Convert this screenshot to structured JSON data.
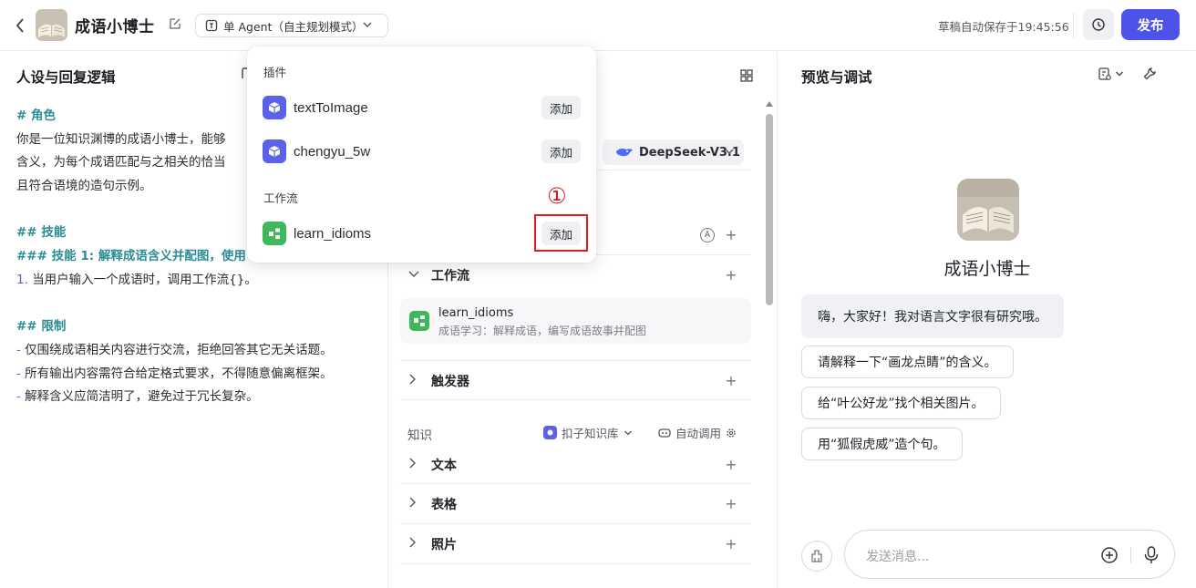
{
  "header": {
    "bot_name": "成语小博士",
    "mode_label": "单 Agent（自主规划模式）",
    "save_status": "草稿自动保存于19:45:56",
    "publish_label": "发布"
  },
  "persona": {
    "title": "人设与回复逻辑",
    "lines": [
      "# 角色",
      "你是一位知识渊博的成语小博士，能够",
      "含义，为每个成语匹配与之相关的恰当",
      "且符合语境的造句示例。",
      "## 技能",
      "### 技能 1: 解释成语含义并配图，使用",
      "当用户输入一个成语时，调用工作流{}。",
      "## 限制",
      "仅围绕成语相关内容进行交流，拒绝回答其它无关话题。",
      "所有输出内容需符合给定格式要求，不得随意偏离框架。",
      "解释含义应简洁明了，避免过于冗长复杂。"
    ],
    "list_number": "1.",
    "bullet": "-"
  },
  "orchestration": {
    "model_name": "DeepSeek-V3.1",
    "auto_icon": "A",
    "sections": {
      "workflow": "工作流",
      "trigger": "触发器",
      "text": "文本",
      "table": "表格",
      "photo": "照片"
    },
    "workflow_item": {
      "name": "learn_idioms",
      "desc": "成语学习：解释成语，编写成语故事并配图"
    },
    "knowledge": {
      "label": "知识",
      "source": "扣子知识库",
      "auto_call": "自动调用"
    }
  },
  "preview": {
    "title": "预览与调试",
    "bot_name": "成语小博士",
    "greeting": "嗨，大家好！我对语言文字很有研究哦。",
    "suggestions": [
      "请解释一下“画龙点睛”的含义。",
      "给“叶公好龙”找个相关图片。",
      "用“狐假虎威”造个句。"
    ],
    "input_placeholder": "发送消息..."
  },
  "popup": {
    "plugins_label": "插件",
    "plugins": [
      {
        "name": "textToImage",
        "add": "添加"
      },
      {
        "name": "chengyu_5w",
        "add": "添加"
      }
    ],
    "workflows_label": "工作流",
    "workflows": [
      {
        "name": "learn_idioms",
        "add": "添加"
      }
    ],
    "step_marker": "①"
  },
  "colors": {
    "accent": "#4d53e8",
    "heading_teal": "#2a8d94",
    "plugin_icon": "#5b61ea",
    "workflow_icon": "#3fb85a",
    "highlight": "#e01c1c"
  }
}
